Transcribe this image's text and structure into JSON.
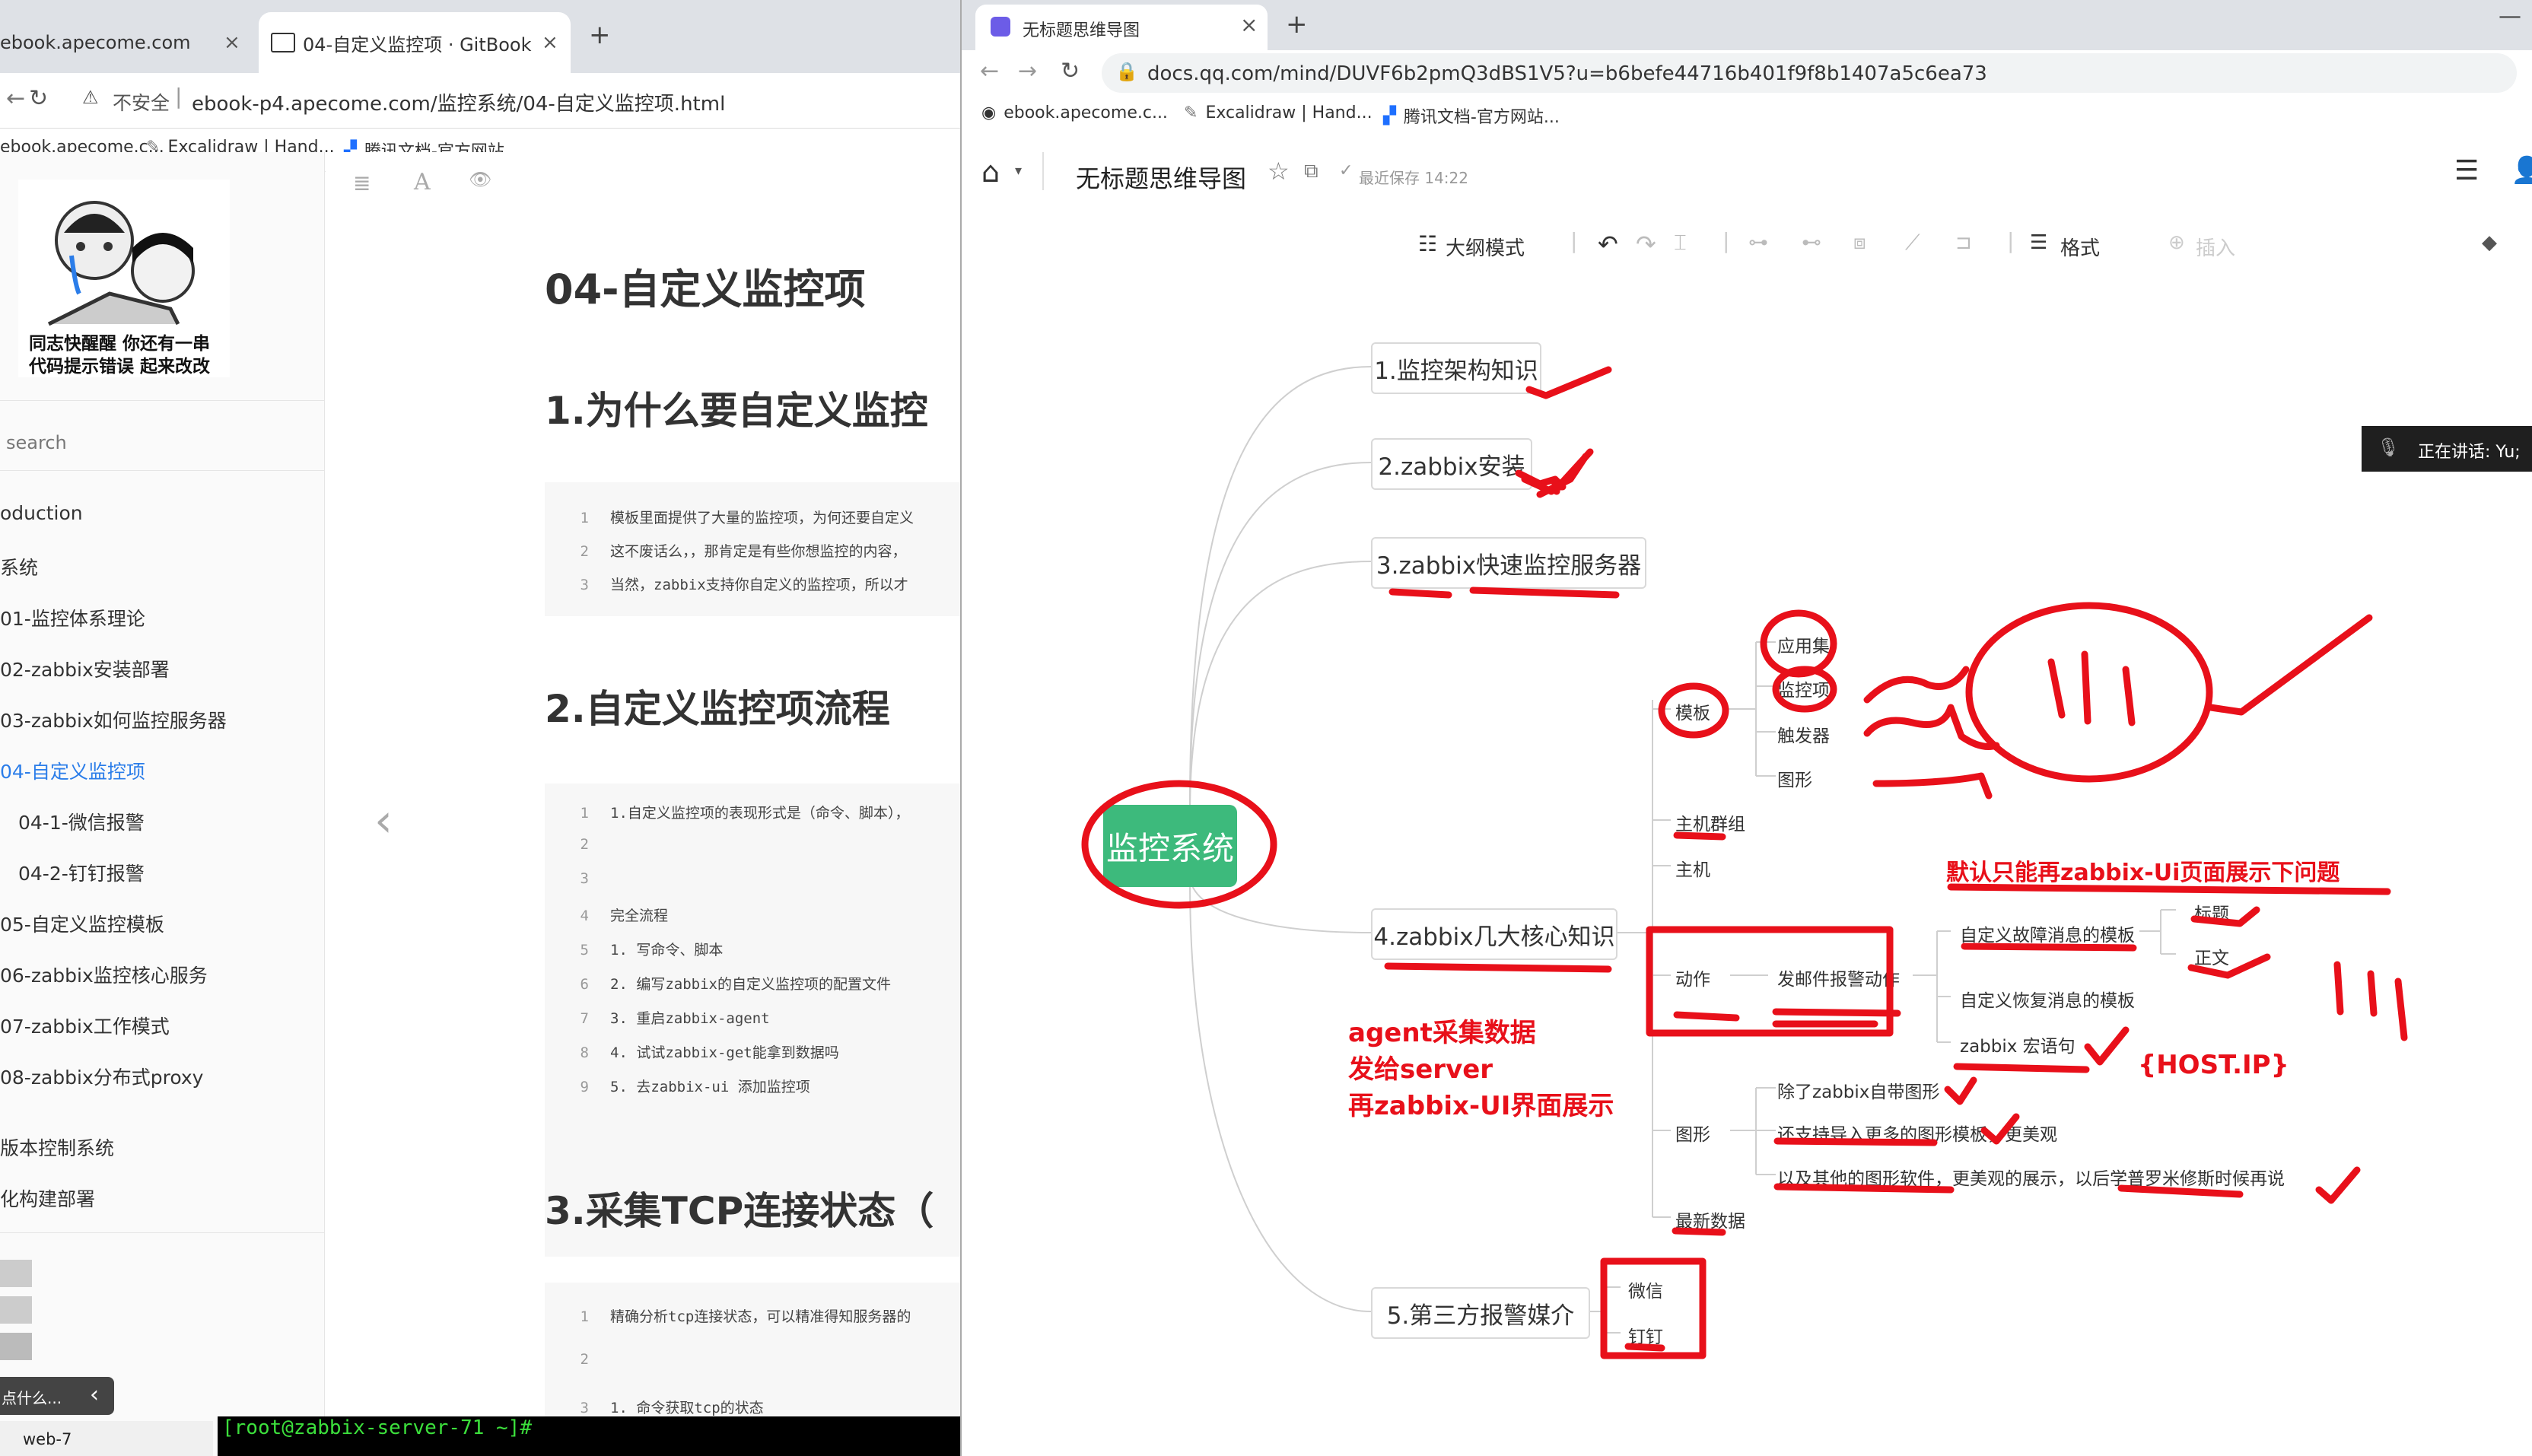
{
  "left": {
    "tabs": [
      {
        "title": "ebook.apecome.com"
      },
      {
        "title": "04-自定义监控项 · GitBook"
      }
    ],
    "new_tab": "+",
    "security_label": "不安全",
    "url": "ebook-p4.apecome.com/监控系统/04-自定义监控项.html",
    "bookmarks": [
      "ebook.apecome.c...",
      "Excalidraw | Hand...",
      "腾讯文档-官方网站..."
    ],
    "sidebar": {
      "meme_caption_line1": "同志快醒醒 你还有一串",
      "meme_caption_line2": "代码提示错误 起来改改",
      "search_placeholder": "search",
      "items": [
        "oduction",
        "系统",
        "01-监控体系理论",
        "02-zabbix安装部署",
        "03-zabbix如何监控服务器",
        "04-自定义监控项",
        "04-1-微信报警",
        "04-2-钉钉报警",
        "05-自定义监控模板",
        "06-zabbix监控核心服务",
        "07-zabbix工作模式",
        "08-zabbix分布式proxy",
        "版本控制系统",
        "化构建部署"
      ],
      "bottom_tip": "点什么...",
      "bottom_chevron": "‹",
      "term_tab": "web-7"
    },
    "toolbar_icons": [
      "list-icon",
      "font-icon",
      "eye-icon"
    ],
    "prev_arrow": "‹",
    "article": {
      "title": "04-自定义监控项",
      "h2_1": "1.为什么要自定义监控",
      "code1": [
        {
          "n": "1",
          "t": "模板里面提供了大量的监控项，为何还要自定义"
        },
        {
          "n": "2",
          "t": "这不废话么，，那肯定是有些你想监控的内容，"
        },
        {
          "n": "3",
          "t": "当然，zabbix支持你自定义的监控项，所以才"
        }
      ],
      "h2_2": "2.自定义监控项流程",
      "code2": [
        {
          "n": "1",
          "t": "1.自定义监控项的表现形式是（命令、脚本），"
        },
        {
          "n": "2",
          "t": ""
        },
        {
          "n": "3",
          "t": ""
        },
        {
          "n": "4",
          "t": "完全流程"
        },
        {
          "n": "5",
          "t": "1. 写命令、脚本"
        },
        {
          "n": "6",
          "t": "2. 编写zabbix的自定义监控项的配置文件"
        },
        {
          "n": "7",
          "t": "3. 重启zabbix-agent"
        },
        {
          "n": "8",
          "t": "4. 试试zabbix-get能拿到数据吗"
        },
        {
          "n": "9",
          "t": "5.  去zabbix-ui 添加监控项"
        }
      ],
      "h2_3": "3.采集TCP连接状态（",
      "code3": [
        {
          "n": "1",
          "t": "精确分析tcp连接状态，可以精准得知服务器的"
        },
        {
          "n": "2",
          "t": ""
        },
        {
          "n": "3",
          "t": "1. 命令获取tcp的状态"
        }
      ]
    },
    "terminal_line": "[root@zabbix-server-71 ~]#"
  },
  "right": {
    "tab_title": "无标题思维导图",
    "tab_close": "×",
    "new_tab": "+",
    "url": "docs.qq.com/mind/DUVF6b2pmQ3dBS1V5?u=b6befe44716b401f9f8b1407a5c6ea73",
    "bookmarks": [
      "ebook.apecome.c...",
      "Excalidraw | Hand...",
      "腾讯文档-官方网站..."
    ],
    "doc_title": "无标题思维导图",
    "save_status": "最近保存 14:22",
    "toolbar": {
      "outline": "大纲模式",
      "format": "格式",
      "insert": "插入"
    },
    "speaking": "正在讲话: Yu;",
    "mindmap": {
      "root": "监控系统",
      "n1": "1.监控架构知识",
      "n2": "2.zabbix安装",
      "n3": "3.zabbix快速监控服务器",
      "n4": "4.zabbix几大核心知识",
      "n5": "5.第三方报警媒介",
      "template": "模板",
      "template_children": [
        "应用集",
        "监控项",
        "触发器",
        "图形"
      ],
      "host_group": "主机群组",
      "host": "主机",
      "action": "动作",
      "send_mail": "发邮件报警动作",
      "fault_tpl": "自定义故障消息的模板",
      "fault_children": [
        "标题",
        "正文"
      ],
      "recover_tpl": "自定义恢复消息的模板",
      "macro": "zabbix 宏语句",
      "graph": "图形",
      "graph_children": [
        "除了zabbix自带图形",
        "还支持导入更多的图形模板，更美观",
        "以及其他的图形软件，更美观的展示，以后学普罗米修斯时候再说"
      ],
      "latest": "最新数据",
      "media_children": [
        "微信",
        "钉钉"
      ]
    },
    "annotations": {
      "default_note": "默认只能再zabbix-Ui页面展示下问题",
      "agent_line1": "agent采集数据",
      "agent_line2": "发给server",
      "agent_line3": "再zabbix-UI界面展示",
      "host_ip": "{HOST.IP}"
    }
  },
  "colors": {
    "root_green": "#3dba7c",
    "annotation_red": "#e8101a",
    "link_blue": "#2b7de9"
  }
}
